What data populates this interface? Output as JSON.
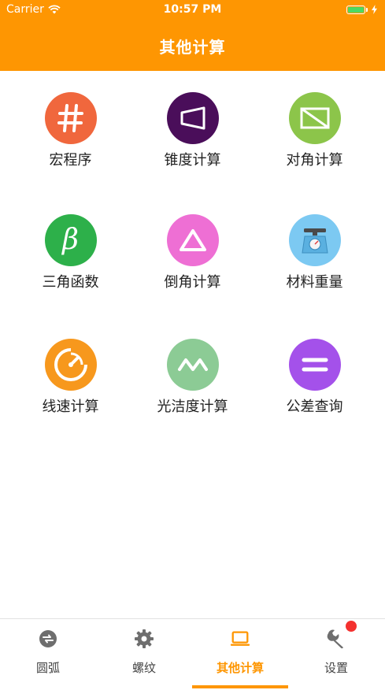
{
  "status_bar": {
    "carrier": "Carrier",
    "time": "10:57 PM"
  },
  "header": {
    "title": "其他计算",
    "background": "#fe9602"
  },
  "grid": {
    "items": [
      {
        "label": "宏程序",
        "icon": "hash-icon",
        "color": "#f0673d"
      },
      {
        "label": "锥度计算",
        "icon": "taper-icon",
        "color": "#4a0e5a"
      },
      {
        "label": "对角计算",
        "icon": "diagonal-rectangle-icon",
        "color": "#8cc54a"
      },
      {
        "label": "三角函数",
        "icon": "beta-icon",
        "color": "#2db04a"
      },
      {
        "label": "倒角计算",
        "icon": "triangle-icon",
        "color": "#ee6fd4"
      },
      {
        "label": "材料重量",
        "icon": "scale-icon",
        "color": "#7cc9f2"
      },
      {
        "label": "线速计算",
        "icon": "speedometer-icon",
        "color": "#f7981d"
      },
      {
        "label": "光洁度计算",
        "icon": "wave-icon",
        "color": "#8ccb95"
      },
      {
        "label": "公差查询",
        "icon": "equals-icon",
        "color": "#a451ea"
      }
    ]
  },
  "tabbar": {
    "tabs": [
      {
        "label": "圆弧",
        "icon": "arc-swap-icon",
        "active": false
      },
      {
        "label": "螺纹",
        "icon": "gear-icon",
        "active": false
      },
      {
        "label": "其他计算",
        "icon": "laptop-icon",
        "active": true
      },
      {
        "label": "设置",
        "icon": "wrench-icon",
        "active": false
      }
    ],
    "active_color": "#fe9602",
    "badge_color": "#f4312f"
  }
}
